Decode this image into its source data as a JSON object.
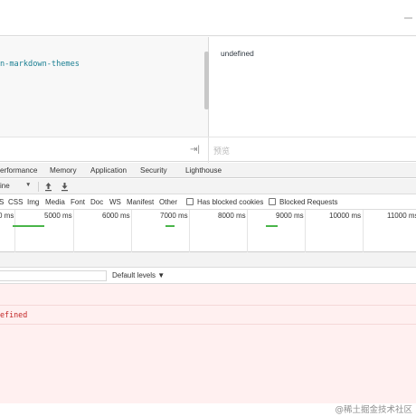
{
  "editor": {
    "code_line": "n-markdown-themes",
    "output_value": "undefined"
  },
  "input_row": {
    "run_glyph": "⇥|",
    "preview_placeholder": "预览"
  },
  "devtools": {
    "tabs": [
      {
        "label": "erformance"
      },
      {
        "label": "Memory"
      },
      {
        "label": "Application"
      },
      {
        "label": "Security"
      },
      {
        "label": "Lighthouse"
      }
    ]
  },
  "network_toolbar": {
    "throttle_label": "ine",
    "caret": "▼"
  },
  "filter_row": {
    "types": [
      "S",
      "CSS",
      "Img",
      "Media",
      "Font",
      "Doc",
      "WS",
      "Manifest",
      "Other"
    ],
    "blocked_cookies_label": "Has blocked cookies",
    "blocked_requests_label": "Blocked Requests"
  },
  "timeline": {
    "ticks": [
      "0 ms",
      "5000 ms",
      "6000 ms",
      "7000 ms",
      "8000 ms",
      "9000 ms",
      "10000 ms",
      "11000 ms"
    ]
  },
  "console": {
    "levels_label": "Default levels ▼",
    "error_text": "efined"
  },
  "watermark": "@稀土掘金技术社区",
  "colors": {
    "code_teal": "#1a7f92",
    "error_red": "#c22525",
    "error_bg": "#fff0f0",
    "timeline_green": "#49b549"
  }
}
